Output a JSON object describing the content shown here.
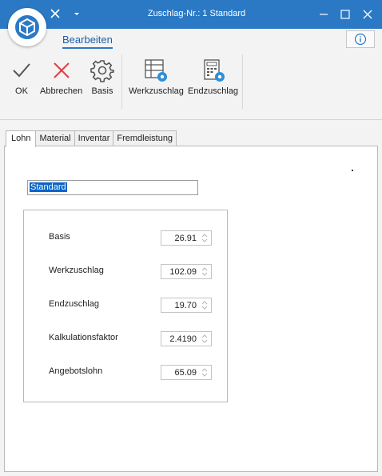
{
  "window": {
    "title": "Zuschlag-Nr.: 1 Standard"
  },
  "ribbon": {
    "tab_label": "Bearbeiten",
    "buttons": {
      "ok": "OK",
      "cancel": "Abbrechen",
      "basis": "Basis",
      "werkzuschlag": "Werkzuschlag",
      "endzuschlag": "Endzuschlag"
    }
  },
  "tabs": [
    "Lohn",
    "Material",
    "Inventar",
    "Fremdleistung"
  ],
  "form": {
    "name_value": "Standard",
    "fields": [
      {
        "label": "Basis",
        "value": "26.91"
      },
      {
        "label": "Werkzuschlag",
        "value": "102.09"
      },
      {
        "label": "Endzuschlag",
        "value": "19.70"
      },
      {
        "label": "Kalkulationsfaktor",
        "value": "2.4190"
      },
      {
        "label": "Angebotslohn",
        "value": "65.09"
      }
    ]
  },
  "colors": {
    "titlebar": "#2b79c4",
    "accent": "#1e5fa6",
    "cancel_red": "#e04040",
    "gear_blue": "#2f8fd8",
    "selection": "#0a64c8"
  }
}
